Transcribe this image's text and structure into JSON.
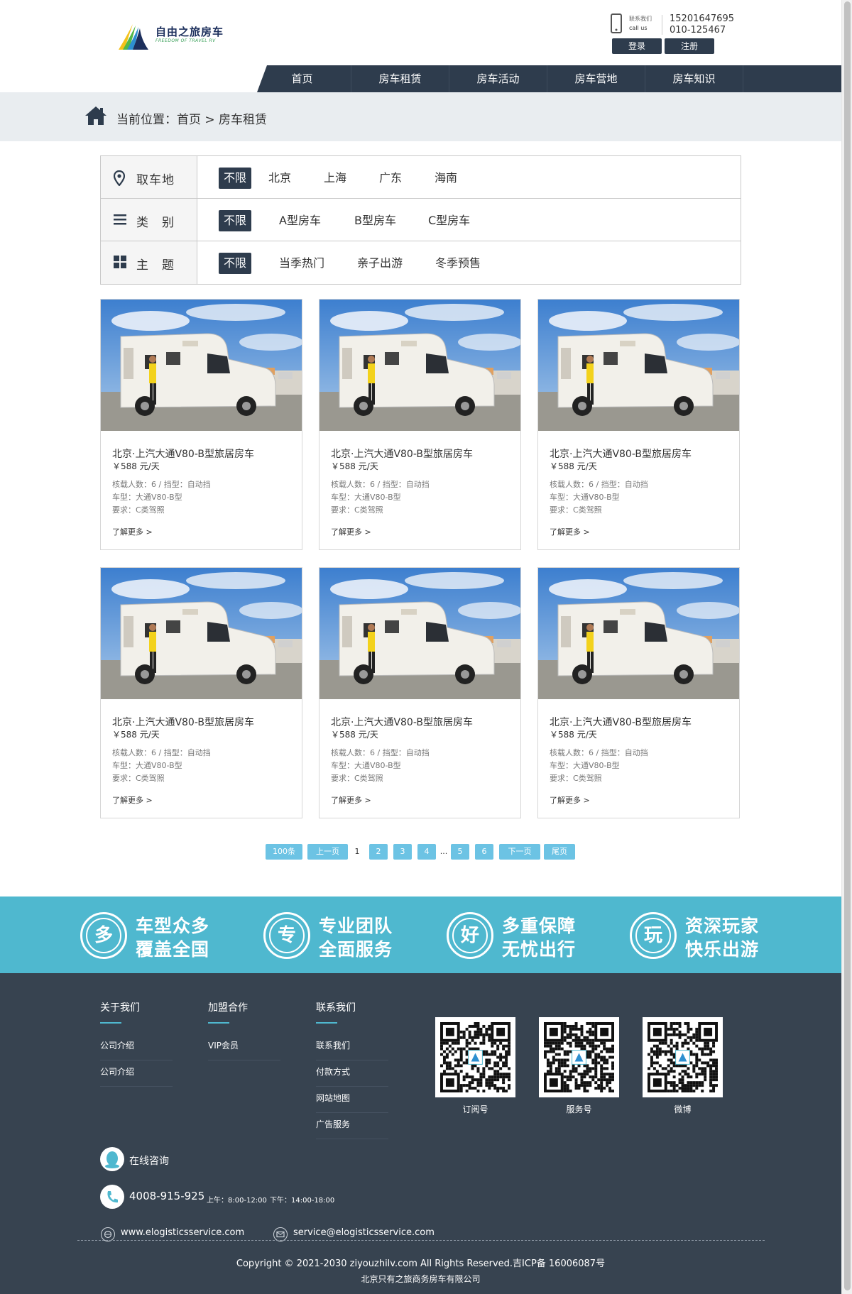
{
  "header": {
    "logo_cn": "自由之旅房车",
    "logo_en": "FREEDOM OF TRAVEL RV",
    "call_cn": "联系我们",
    "call_en": "call us",
    "phone1": "15201647695",
    "phone2": "010-125467",
    "login": "登录",
    "register": "注册"
  },
  "nav": [
    "首页",
    "房车租赁",
    "房车活动",
    "房车营地",
    "房车知识"
  ],
  "breadcrumb": "当前位置：首页 > 房车租赁",
  "filters": [
    {
      "label": "取车地",
      "icon": "map-pin-icon",
      "options": [
        "不限",
        "北京",
        "上海",
        "广东",
        "海南"
      ]
    },
    {
      "label": "类　别",
      "icon": "list-icon",
      "options": [
        "不限",
        "A型房车",
        "B型房车",
        "C型房车"
      ]
    },
    {
      "label": "主　题",
      "icon": "grid-icon",
      "options": [
        "不限",
        "当季热门",
        "亲子出游",
        "冬季预售"
      ]
    }
  ],
  "cars": [
    {
      "title": "北京·上汽大通V80-B型旅居房车",
      "price": "￥588 元/天",
      "spec1": "核载人数：6 / 挡型：自动挡",
      "spec2": "车型：大通V80-B型",
      "spec3": "要求：C类驾照",
      "more": "了解更多 >"
    },
    {
      "title": "北京·上汽大通V80-B型旅居房车",
      "price": "￥588 元/天",
      "spec1": "核载人数：6 / 挡型：自动挡",
      "spec2": "车型：大通V80-B型",
      "spec3": "要求：C类驾照",
      "more": "了解更多 >"
    },
    {
      "title": "北京·上汽大通V80-B型旅居房车",
      "price": "￥588 元/天",
      "spec1": "核载人数：6 / 挡型：自动挡",
      "spec2": "车型：大通V80-B型",
      "spec3": "要求：C类驾照",
      "more": "了解更多 >"
    },
    {
      "title": "北京·上汽大通V80-B型旅居房车",
      "price": "￥588 元/天",
      "spec1": "核载人数：6 / 挡型：自动挡",
      "spec2": "车型：大通V80-B型",
      "spec3": "要求：C类驾照",
      "more": "了解更多 >"
    },
    {
      "title": "北京·上汽大通V80-B型旅居房车",
      "price": "￥588 元/天",
      "spec1": "核载人数：6 / 挡型：自动挡",
      "spec2": "车型：大通V80-B型",
      "spec3": "要求：C类驾照",
      "more": "了解更多 >"
    },
    {
      "title": "北京·上汽大通V80-B型旅居房车",
      "price": "￥588 元/天",
      "spec1": "核载人数：6 / 挡型：自动挡",
      "spec2": "车型：大通V80-B型",
      "spec3": "要求：C类驾照",
      "more": "了解更多 >"
    }
  ],
  "pagination": [
    "100条",
    "上一页",
    "1",
    "2",
    "3",
    "4",
    "...",
    "5",
    "6",
    "下一页",
    "尾页"
  ],
  "features": [
    {
      "glyph": "多",
      "line1": "车型众多",
      "line2": "覆盖全国"
    },
    {
      "glyph": "专",
      "line1": "专业团队",
      "line2": "全面服务"
    },
    {
      "glyph": "好",
      "line1": "多重保障",
      "line2": "无忧出行"
    },
    {
      "glyph": "玩",
      "line1": "资深玩家",
      "line2": "快乐出游"
    }
  ],
  "footer": {
    "columns": [
      {
        "title": "关于我们",
        "links": [
          "公司介绍",
          "公司介绍"
        ]
      },
      {
        "title": "加盟合作",
        "links": [
          "VIP会员"
        ]
      },
      {
        "title": "联系我们",
        "links": [
          "联系我们",
          "付款方式",
          "网站地图",
          "广告服务"
        ]
      }
    ],
    "qrcodes": [
      "订阅号",
      "服务号",
      "微博"
    ],
    "consult": "在线咨询",
    "hotline": "4008-915-925",
    "hours_am": "上午：8:00-12:00",
    "hours_pm": "下午：14:00-18:00",
    "website": "www.elogisticsservice.com",
    "email": "service@elogisticsservice.com",
    "copyright": "Copyright © 2021-2030 ziyouzhilv.com All Rights Reserved.吉ICP备 16006087号",
    "company": "北京只有之旅商务房车有限公司"
  },
  "colors": {
    "dark": "#2e3c4d",
    "accent": "#4fb8cf",
    "page_btn": "#6cc3e4",
    "footer": "#374350"
  }
}
